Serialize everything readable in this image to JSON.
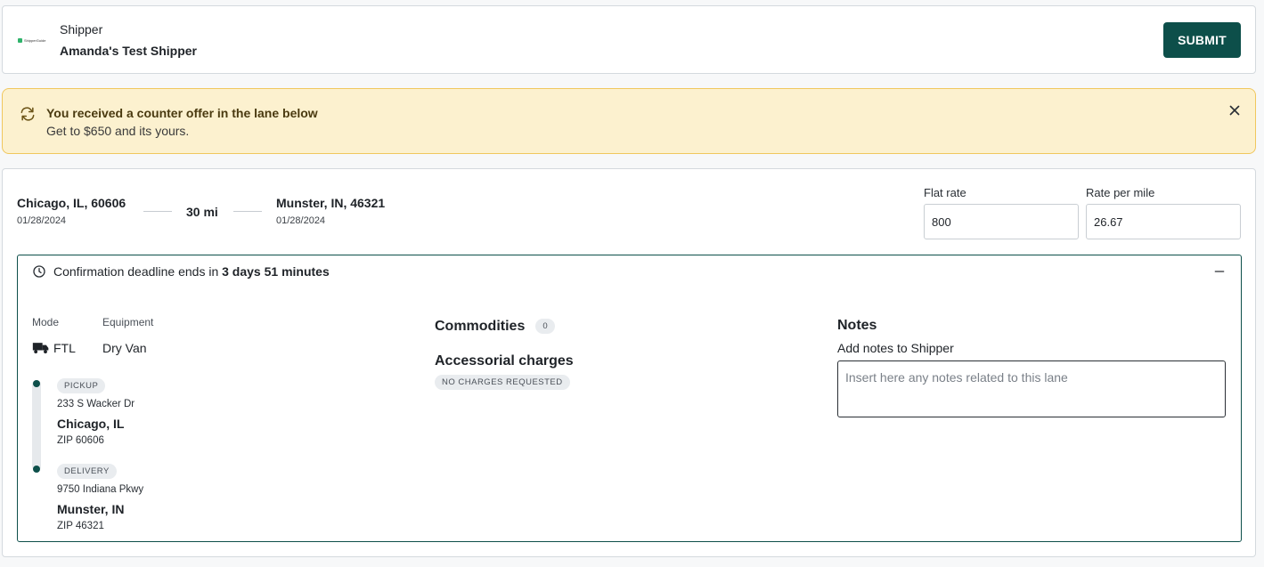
{
  "header": {
    "logo_text": "ShipperGuide",
    "shipper_label": "Shipper",
    "shipper_name": "Amanda's Test Shipper",
    "submit_label": "SUBMIT"
  },
  "alert": {
    "icon": "arrows-exchange-icon",
    "title": "You received a counter offer in the lane below",
    "message": "Get to $650 and its yours.",
    "close_icon": "close-icon"
  },
  "lane": {
    "origin": {
      "city": "Chicago, IL, 60606",
      "date": "01/28/2024"
    },
    "distance": "30 mi",
    "destination": {
      "city": "Munster, IN, 46321",
      "date": "01/28/2024"
    },
    "flat_rate": {
      "label": "Flat rate",
      "value": "800"
    },
    "rate_per_mile": {
      "label": "Rate per mile",
      "value": "26.67"
    }
  },
  "details": {
    "deadline_prefix": "Confirmation deadline ends in ",
    "deadline_value": "3 days 51 minutes",
    "mode_label": "Mode",
    "mode_value": "FTL",
    "equipment_label": "Equipment",
    "equipment_value": "Dry Van",
    "pickup": {
      "tag": "PICKUP",
      "street": "233 S Wacker Dr",
      "city": "Chicago, IL",
      "zip": "ZIP 60606"
    },
    "delivery": {
      "tag": "DELIVERY",
      "street": "9750 Indiana Pkwy",
      "city": "Munster, IN",
      "zip": "ZIP 46321"
    },
    "commodities_title": "Commodities",
    "commodities_count": "0",
    "accessorial_title": "Accessorial charges",
    "accessorial_status": "NO CHARGES REQUESTED",
    "notes_title": "Notes",
    "notes_sublabel": "Add notes to Shipper",
    "notes_value": "",
    "notes_placeholder": "Insert here any notes related to this lane"
  },
  "colors": {
    "primary": "#0d4f4a",
    "alert_bg": "#fcf1cf",
    "alert_border": "#f0c75e"
  }
}
